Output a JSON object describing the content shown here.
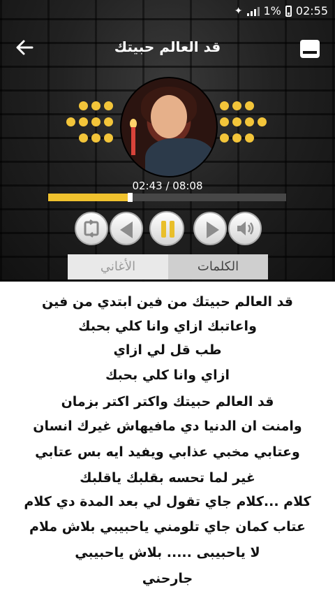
{
  "status_bar": {
    "battery": "1%",
    "time": "02:55"
  },
  "toolbar": {
    "title": "قد العالم حبيتك"
  },
  "player": {
    "time_display": "02:43 / 08:08",
    "progress": 0.342
  },
  "tabs": {
    "lyrics": "الكلمات",
    "songs": "الأغاني",
    "active": "lyrics"
  },
  "lyrics": [
    "قد العالم حبيتك من فين ابتدي من فين",
    "واعاتبك ازاي وانا كلي بحبك",
    "طب قل لي ازاي",
    "ازاي وانا كلي بحبك",
    "قد العالم حبيتك واكتر اكتر بزمان",
    "وامنت ان الدنيا دي مافيهاش غيرك انسان",
    "وعتابي مخبي عذابي ويفيد ايه بس عتابي",
    "غير لما تحسه بقلبك ياقلبك",
    "كلام ...كلام جاي تقول لي بعد المدة دي كلام",
    "عتاب كمان جاي تلومني ياحبيبي بلاش ملام",
    "لا ياحبيبى ..... بلاش ياحبيبي",
    "جارحني"
  ],
  "colors": {
    "accent": "#f0c22e",
    "background": "#141414"
  },
  "icons": [
    "back-arrow-icon",
    "menu-icon",
    "repeat-icon",
    "previous-icon",
    "pause-icon",
    "next-icon",
    "volume-icon"
  ]
}
